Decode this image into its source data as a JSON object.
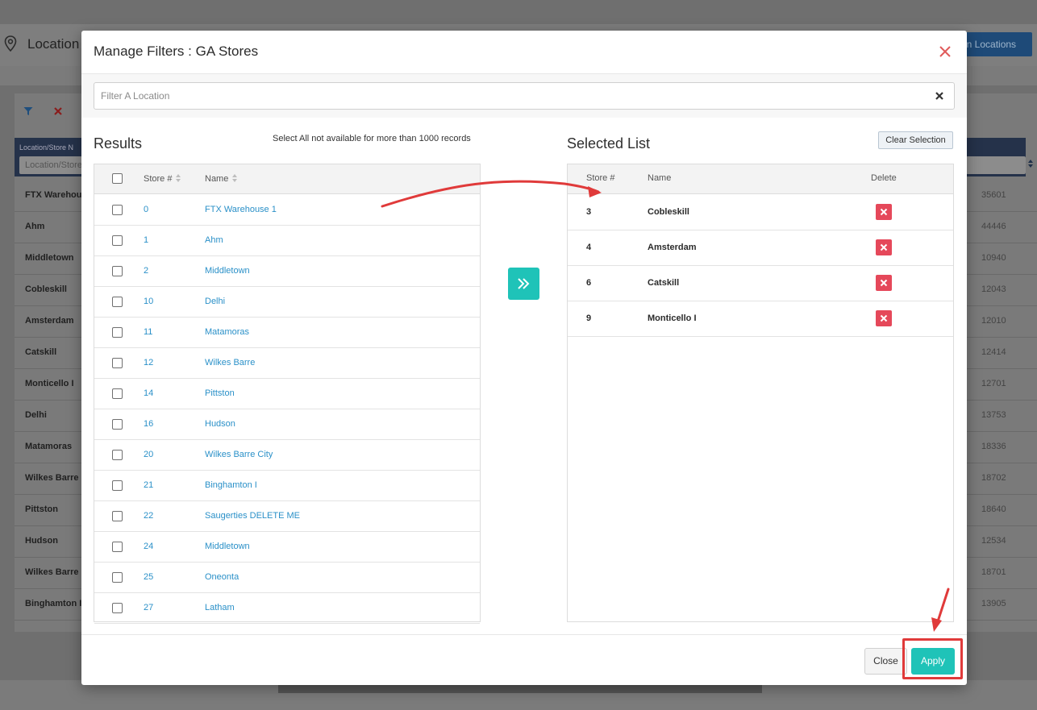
{
  "background": {
    "page_title": "Location",
    "assign_button": "gn Locations",
    "column_header": "Location/Store N",
    "column_filter_placeholder": "Location/Store",
    "rows": [
      {
        "name": "FTX Warehou",
        "value": "35601"
      },
      {
        "name": "Ahm",
        "value": "44446"
      },
      {
        "name": "Middletown",
        "value": "10940"
      },
      {
        "name": "Cobleskill",
        "value": "12043"
      },
      {
        "name": "Amsterdam",
        "value": "12010"
      },
      {
        "name": "Catskill",
        "value": "12414"
      },
      {
        "name": "Monticello I",
        "value": "12701"
      },
      {
        "name": "Delhi",
        "value": "13753"
      },
      {
        "name": "Matamoras",
        "value": "18336"
      },
      {
        "name": "Wilkes Barre",
        "value": "18702"
      },
      {
        "name": "Pittston",
        "value": "18640"
      },
      {
        "name": "Hudson",
        "value": "12534"
      },
      {
        "name": "Wilkes Barre",
        "value": "18701"
      },
      {
        "name": "Binghamton I",
        "value": "13905"
      }
    ]
  },
  "modal": {
    "title": "Manage Filters : GA Stores",
    "search": {
      "placeholder": "Filter A Location",
      "value": ""
    },
    "results": {
      "title": "Results",
      "note": "Select All not available for more than 1000 records",
      "columns": {
        "store": "Store #",
        "name": "Name"
      },
      "rows": [
        {
          "store": "0",
          "name": "FTX Warehouse 1"
        },
        {
          "store": "1",
          "name": "Ahm"
        },
        {
          "store": "2",
          "name": "Middletown"
        },
        {
          "store": "10",
          "name": "Delhi"
        },
        {
          "store": "11",
          "name": "Matamoras"
        },
        {
          "store": "12",
          "name": "Wilkes Barre"
        },
        {
          "store": "14",
          "name": "Pittston"
        },
        {
          "store": "16",
          "name": "Hudson"
        },
        {
          "store": "20",
          "name": "Wilkes Barre City"
        },
        {
          "store": "21",
          "name": "Binghamton I"
        },
        {
          "store": "22",
          "name": "Saugerties DELETE ME"
        },
        {
          "store": "24",
          "name": "Middletown"
        },
        {
          "store": "25",
          "name": "Oneonta"
        },
        {
          "store": "27",
          "name": "Latham"
        }
      ]
    },
    "selected": {
      "title": "Selected List",
      "clear_button": "Clear Selection",
      "columns": {
        "store": "Store #",
        "name": "Name",
        "delete": "Delete"
      },
      "rows": [
        {
          "store": "3",
          "name": "Cobleskill"
        },
        {
          "store": "4",
          "name": "Amsterdam"
        },
        {
          "store": "6",
          "name": "Catskill"
        },
        {
          "store": "9",
          "name": "Monticello I"
        }
      ]
    },
    "footer": {
      "close_label": "Close",
      "apply_label": "Apply"
    }
  },
  "colors": {
    "accent": "#1fc3b8",
    "link": "#2a90c8",
    "danger": "#e5485a",
    "annotation": "#e03a3a"
  }
}
